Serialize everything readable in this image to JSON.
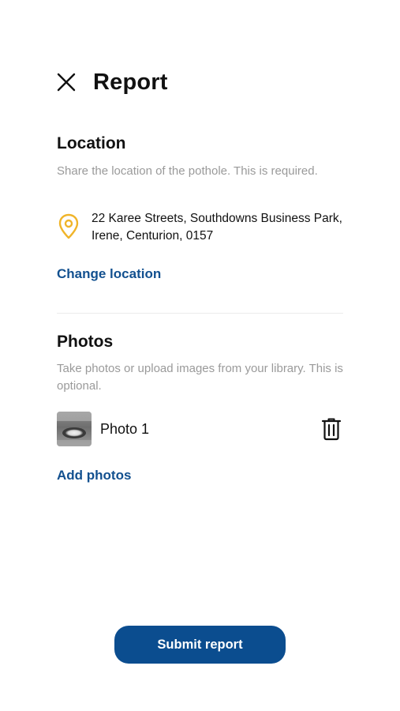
{
  "header": {
    "title": "Report",
    "close_icon": "close-icon"
  },
  "location": {
    "title": "Location",
    "helper": "Share the location of the pothole. This is required.",
    "address": "22 Karee Streets, Southdowns Business Park, Irene, Centurion, 0157",
    "icon": "map-pin-icon",
    "change_label": "Change location"
  },
  "photos": {
    "title": "Photos",
    "helper": "Take photos or upload images from your library. This is optional.",
    "items": [
      {
        "label": "Photo 1",
        "delete_icon": "trash-icon"
      }
    ],
    "add_label": "Add photos"
  },
  "submit": {
    "label": "Submit report"
  },
  "colors": {
    "accent": "#12508f",
    "button": "#0b4d8f",
    "pin": "#f0b429",
    "helper_text": "#9a9a9a"
  }
}
